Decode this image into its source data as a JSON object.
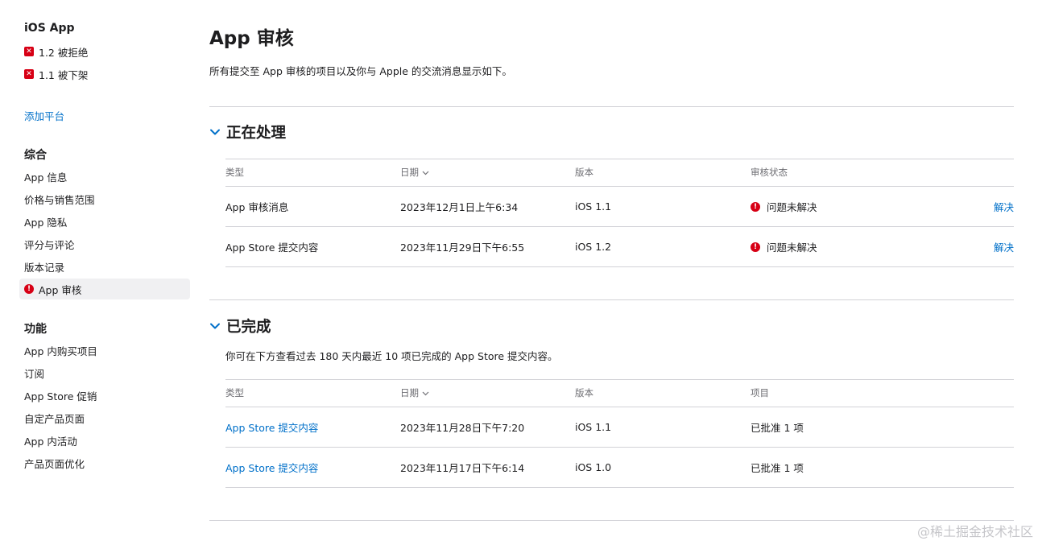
{
  "sidebar": {
    "app_title": "iOS App",
    "statuses": [
      {
        "label": "1.2 被拒绝"
      },
      {
        "label": "1.1 被下架"
      }
    ],
    "add_platform": "添加平台",
    "general_title": "综合",
    "general_items": [
      {
        "label": "App 信息"
      },
      {
        "label": "价格与销售范围"
      },
      {
        "label": "App 隐私"
      },
      {
        "label": "评分与评论"
      },
      {
        "label": "版本记录"
      },
      {
        "label": "App 审核",
        "active": true
      }
    ],
    "features_title": "功能",
    "features_items": [
      {
        "label": "App 内购买项目"
      },
      {
        "label": "订阅"
      },
      {
        "label": "App Store 促销"
      },
      {
        "label": "自定产品页面"
      },
      {
        "label": "App 内活动"
      },
      {
        "label": "产品页面优化"
      }
    ]
  },
  "main": {
    "title": "App 审核",
    "description": "所有提交至 App 审核的项目以及你与 Apple 的交流消息显示如下。",
    "in_progress": {
      "title": "正在处理",
      "columns": [
        "类型",
        "日期",
        "版本",
        "审核状态"
      ],
      "rows": [
        {
          "type": "App 审核消息",
          "date": "2023年12月1日上午6:34",
          "version": "iOS 1.1",
          "status": "问题未解决",
          "action": "解决"
        },
        {
          "type": "App Store 提交内容",
          "date": "2023年11月29日下午6:55",
          "version": "iOS 1.2",
          "status": "问题未解决",
          "action": "解决"
        }
      ]
    },
    "completed": {
      "title": "已完成",
      "description": "你可在下方查看过去 180 天内最近 10 项已完成的 App Store 提交内容。",
      "columns": [
        "类型",
        "日期",
        "版本",
        "项目"
      ],
      "rows": [
        {
          "type": "App Store 提交内容",
          "date": "2023年11月28日下午7:20",
          "version": "iOS 1.1",
          "items": "已批准 1 项"
        },
        {
          "type": "App Store 提交内容",
          "date": "2023年11月17日下午6:14",
          "version": "iOS 1.0",
          "items": "已批准 1 项"
        }
      ]
    }
  },
  "watermark": "@稀土掘金技术社区",
  "colors": {
    "accent_link": "#0070c9",
    "error_red": "#d70015",
    "divider": "#d2d2d7",
    "active_bg": "#f0f0f2"
  },
  "icons": {
    "rejected": "x-square-icon",
    "issue": "exclamation-circle-icon",
    "collapse": "chevron-down-icon",
    "sort": "chevron-down-icon"
  }
}
